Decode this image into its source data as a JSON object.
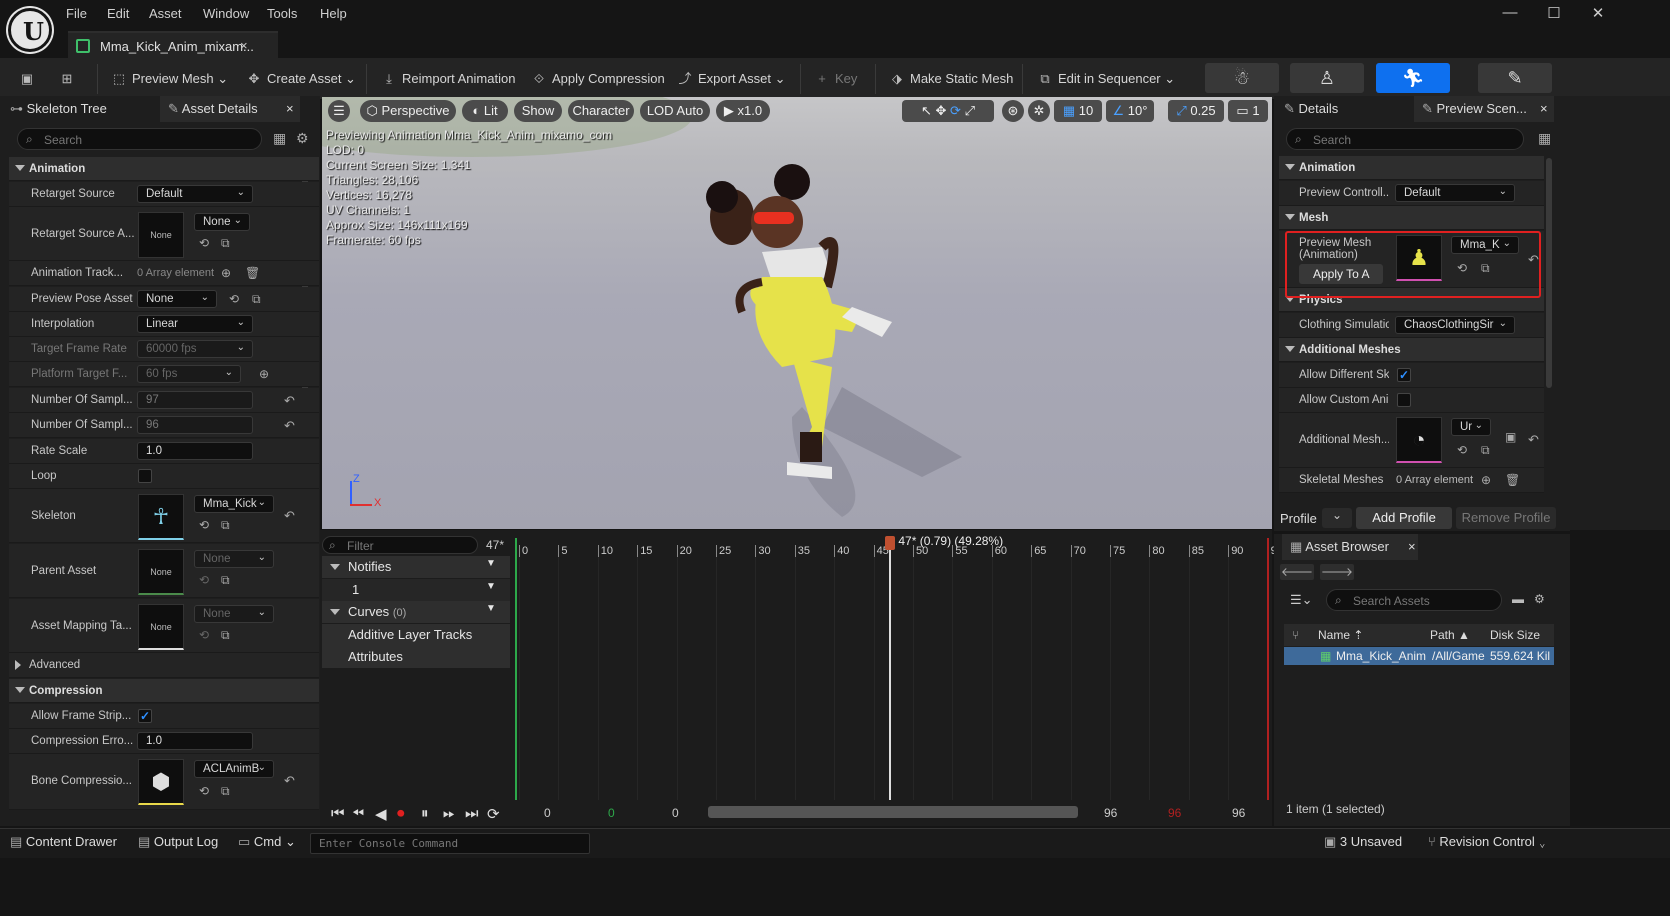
{
  "window": {
    "menu": [
      "File",
      "Edit",
      "Asset",
      "Window",
      "Tools",
      "Help"
    ],
    "tab_title": "Mma_Kick_Anim_mixam...",
    "tab_close": "×",
    "controls": {
      "minimize": "—",
      "maximize": "☐",
      "close": "✕"
    }
  },
  "toolbar": {
    "preview_mesh": "Preview Mesh",
    "create_asset": "Create Asset",
    "reimport": "Reimport Animation",
    "apply_compression": "Apply Compression",
    "export_asset": "Export Asset",
    "key": "Key",
    "make_static_mesh": "Make Static Mesh",
    "edit_in_sequencer": "Edit in Sequencer",
    "modes": [
      "skeleton-mode",
      "mesh-mode",
      "animation-mode",
      "blueprint-mode"
    ],
    "active_mode": "animation-mode",
    "accent": "#0e70ef"
  },
  "left": {
    "tabs": {
      "skeleton_tree": "Skeleton Tree",
      "asset_details": "Asset Details",
      "close": "×"
    },
    "search_placeholder": "Search",
    "sections": {
      "animation": "Animation",
      "advanced": "Advanced",
      "compression": "Compression"
    },
    "props": {
      "retarget_source": {
        "label": "Retarget Source",
        "value": "Default"
      },
      "retarget_source_asset": {
        "label": "Retarget Source A...",
        "thumb": "None",
        "value": "None"
      },
      "animation_tracks": {
        "label": "Animation Track...",
        "value": "0 Array element"
      },
      "preview_pose": {
        "label": "Preview Pose Asset",
        "value": "None"
      },
      "interpolation": {
        "label": "Interpolation",
        "value": "Linear"
      },
      "target_frame_rate": {
        "label": "Target Frame Rate",
        "value": "60000 fps"
      },
      "platform_target": {
        "label": "Platform Target F...",
        "value": "60 fps"
      },
      "num_samples_1": {
        "label": "Number Of Sampl...",
        "value": "97"
      },
      "num_samples_2": {
        "label": "Number Of Sampl...",
        "value": "96"
      },
      "rate_scale": {
        "label": "Rate Scale",
        "value": "1.0"
      },
      "loop": {
        "label": "Loop"
      },
      "skeleton": {
        "label": "Skeleton",
        "value": "Mma_Kick"
      },
      "parent_asset": {
        "label": "Parent Asset",
        "thumb": "None",
        "value": "None"
      },
      "asset_mapping": {
        "label": "Asset Mapping Ta...",
        "thumb": "None",
        "value": "None"
      },
      "allow_frame_strip": {
        "label": "Allow Frame Strip...",
        "checked": true
      },
      "compression_error": {
        "label": "Compression Erro...",
        "value": "1.0"
      },
      "bone_compression": {
        "label": "Bone Compressio...",
        "value": "ACLAnimB"
      }
    }
  },
  "viewport": {
    "perspective": "Perspective",
    "lit": "Lit",
    "show": "Show",
    "character": "Character",
    "lod": "LOD Auto",
    "speed": "x1.0",
    "grid_snap": "10",
    "rot_snap": "10°",
    "scale_snap": "0.25",
    "cam_speed": "1",
    "info": [
      "Previewing Animation Mma_Kick_Anim_mixamo_com",
      "LOD: 0",
      "Current Screen Size: 1.341",
      "Triangles: 28,106",
      "Vertices: 16,278",
      "UV Channels: 1",
      "Approx Size: 146x111x169",
      "Framerate: 60 fps"
    ],
    "axis": {
      "z": "Z",
      "x": "X"
    }
  },
  "timeline": {
    "filter_placeholder": "Filter",
    "current_frame": "47*",
    "playhead_label": "47* (0.79) (49.28%)",
    "playhead_frame": 47,
    "total_frames": 96,
    "ticks": [
      "0",
      "5",
      "10",
      "15",
      "20",
      "25",
      "30",
      "35",
      "40",
      "45",
      "50",
      "55",
      "60",
      "65",
      "70",
      "75",
      "80",
      "85",
      "90",
      "9"
    ],
    "tracks": {
      "notifies": "Notifies",
      "notify_1": "1",
      "curves": "Curves",
      "curves_count": "(0)",
      "additive": "Additive Layer Tracks",
      "attributes": "Attributes"
    },
    "range": {
      "start": "0",
      "start_green": "0",
      "view_start": "0",
      "view_end": "96",
      "end_red": "96",
      "end": "96"
    }
  },
  "right": {
    "tabs": {
      "details": "Details",
      "preview_scene": "Preview Scen...",
      "close": "×"
    },
    "search_placeholder": "Search",
    "sections": {
      "animation": "Animation",
      "mesh": "Mesh",
      "physics": "Physics",
      "additional_meshes": "Additional Meshes"
    },
    "props": {
      "preview_controller": {
        "label": "Preview Controll...",
        "value": "Default"
      },
      "preview_mesh": {
        "label": "Preview Mesh (Animation)",
        "value": "Mma_K",
        "apply": "Apply To A"
      },
      "clothing": {
        "label": "Clothing Simulatio",
        "value": "ChaosClothingSir"
      },
      "allow_diff": {
        "label": "Allow Different Sk",
        "checked": true
      },
      "allow_custom": {
        "label": "Allow Custom Anir",
        "checked": false
      },
      "additional_mesh": {
        "label": "Additional Mesh...",
        "value": "Ur"
      },
      "skeletal_meshes": {
        "label": "Skeletal Meshes",
        "value": "0 Array element"
      }
    },
    "profile": {
      "label": "Profile",
      "add": "Add Profile",
      "remove": "Remove Profile"
    },
    "highlight_color": "#e02020"
  },
  "asset_browser": {
    "title": "Asset Browser",
    "close": "×",
    "search_placeholder": "Search Assets",
    "columns": {
      "name": "Name",
      "path": "Path",
      "disk": "Disk Size"
    },
    "rows": [
      {
        "name": "Mma_Kick_Anim",
        "path": "/All/Game",
        "disk": "559.624 Kil"
      }
    ],
    "status": "1 item (1 selected)"
  },
  "statusbar": {
    "content_drawer": "Content Drawer",
    "output_log": "Output Log",
    "cmd": "Cmd",
    "console_placeholder": "Enter Console Command",
    "unsaved": "3 Unsaved",
    "revision": "Revision Control"
  }
}
